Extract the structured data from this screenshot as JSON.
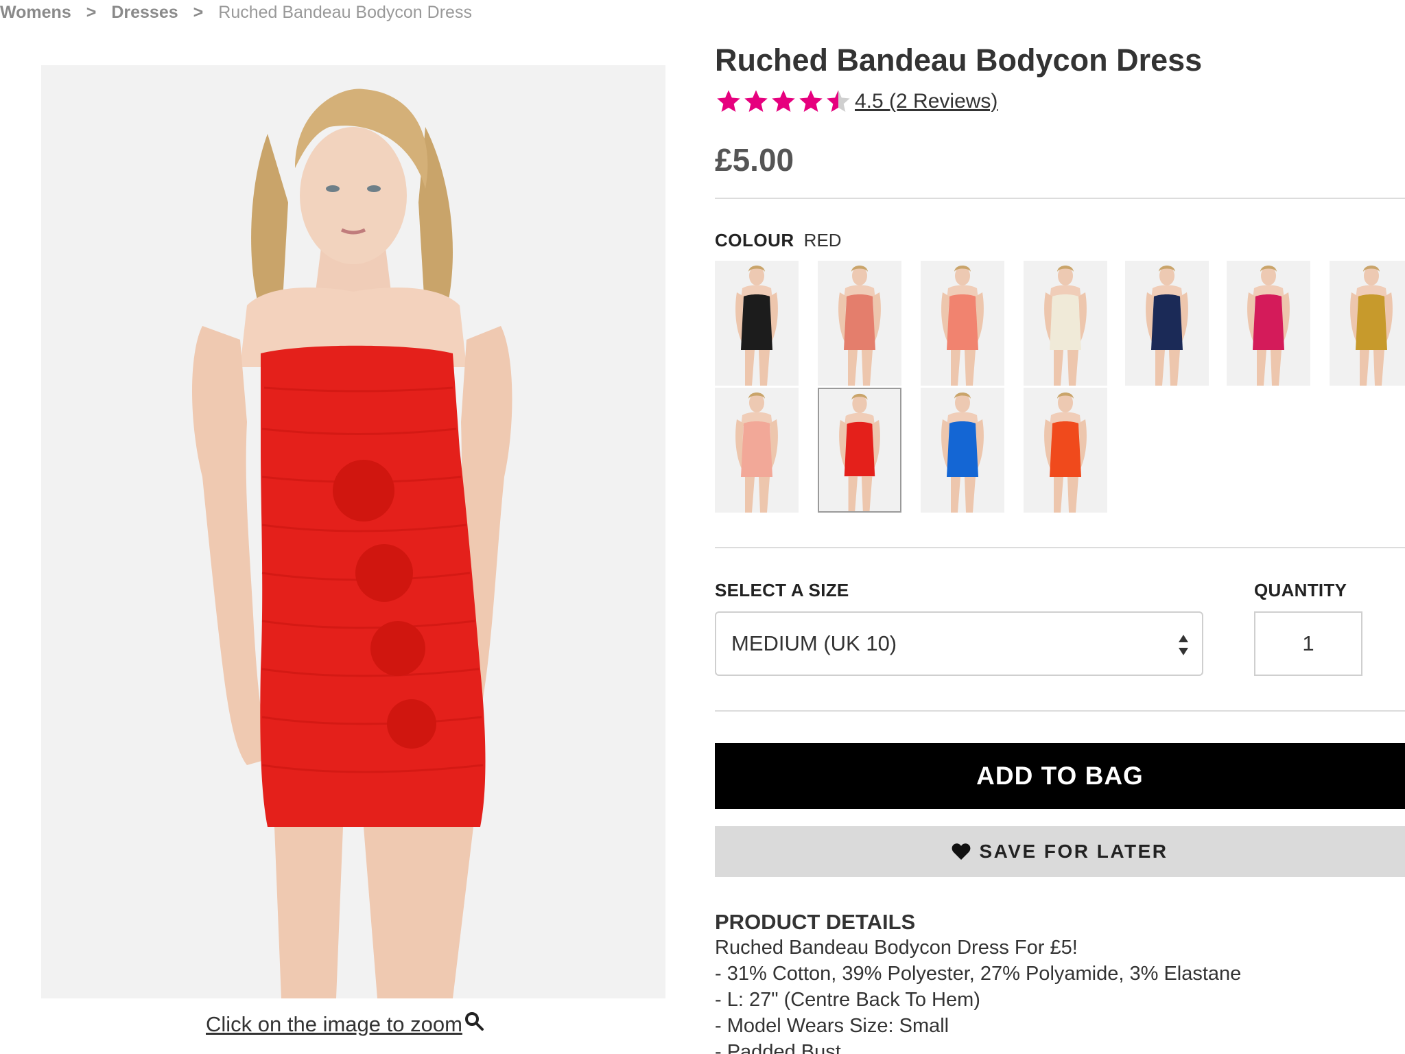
{
  "breadcrumb": {
    "items": [
      {
        "label": "Womens"
      },
      {
        "label": "Dresses"
      }
    ],
    "separator": ">",
    "current": "Ruched Bandeau Bodycon Dress"
  },
  "product": {
    "title": "Ruched Bandeau Bodycon Dress",
    "rating": 4.5,
    "rating_text": "4.5 (2 Reviews)",
    "price": "£5.00",
    "star_color": "#e6007e",
    "main_image_dress_color": "#e4201b"
  },
  "gallery": {
    "zoom_hint": "Click on the image to zoom"
  },
  "colour": {
    "label": "COLOUR",
    "selected": "RED",
    "swatches": [
      {
        "color": "#1c1c1c",
        "selected": false
      },
      {
        "color": "#e47e6c",
        "selected": false
      },
      {
        "color": "#f1836f",
        "selected": false
      },
      {
        "color": "#f0ead8",
        "selected": false
      },
      {
        "color": "#1b2a57",
        "selected": false
      },
      {
        "color": "#d41b5a",
        "selected": false
      },
      {
        "color": "#c79a2c",
        "selected": false
      },
      {
        "color": "#f2a898",
        "selected": false
      },
      {
        "color": "#e4201b",
        "selected": true
      },
      {
        "color": "#1466d4",
        "selected": false
      },
      {
        "color": "#f04a1c",
        "selected": false
      }
    ]
  },
  "size": {
    "label": "SELECT A SIZE",
    "selected": "MEDIUM (UK 10)"
  },
  "quantity": {
    "label": "QUANTITY",
    "value": "1"
  },
  "actions": {
    "add_to_bag": "ADD TO BAG",
    "save_for_later": "SAVE FOR LATER"
  },
  "details": {
    "heading": "PRODUCT DETAILS",
    "lines": [
      "Ruched Bandeau Bodycon Dress For £5!",
      "- 31% Cotton, 39% Polyester, 27% Polyamide, 3% Elastane",
      "- L: 27\" (Centre Back To Hem)",
      "- Model Wears Size: Small",
      "- Padded Bust"
    ]
  }
}
